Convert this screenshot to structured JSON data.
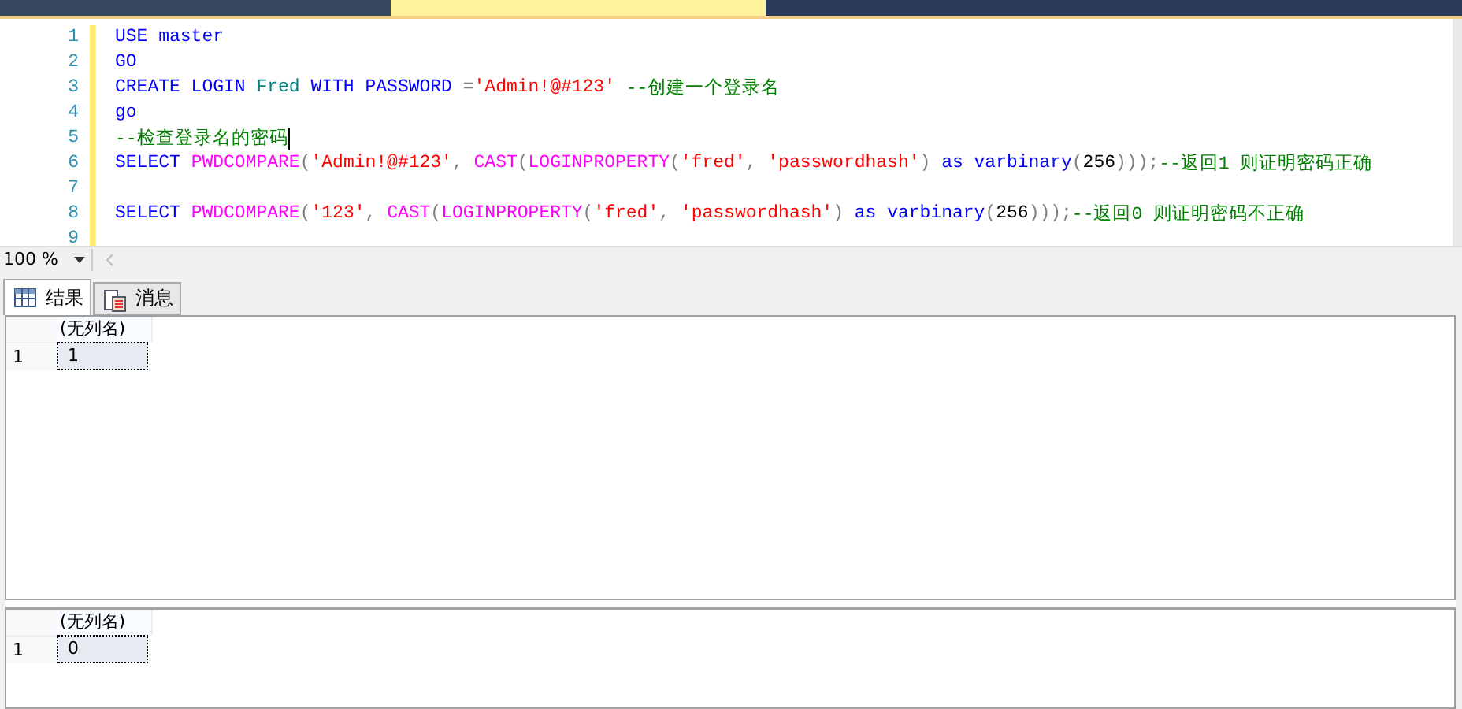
{
  "document_tabs": [
    {
      "selected": false
    },
    {
      "selected": true
    }
  ],
  "editor": {
    "lines": [
      {
        "number": "1",
        "tokens": [
          {
            "kind": "keyword",
            "text": "USE master"
          }
        ]
      },
      {
        "number": "2",
        "tokens": [
          {
            "kind": "keyword",
            "text": "GO"
          }
        ]
      },
      {
        "number": "3",
        "tokens": [
          {
            "kind": "keyword",
            "text": "CREATE LOGIN "
          },
          {
            "kind": "object",
            "text": "Fred"
          },
          {
            "kind": "keyword",
            "text": " WITH PASSWORD "
          },
          {
            "kind": "operator",
            "text": "="
          },
          {
            "kind": "string",
            "text": "'Admin!@#123'"
          },
          {
            "kind": "comment",
            "text": " --创建一个登录名"
          }
        ]
      },
      {
        "number": "4",
        "tokens": [
          {
            "kind": "keyword",
            "text": "go"
          }
        ]
      },
      {
        "number": "5",
        "tokens": [
          {
            "kind": "comment",
            "text": "--检查登录名的密码"
          }
        ],
        "cursor": true
      },
      {
        "number": "6",
        "tokens": [
          {
            "kind": "keyword",
            "text": "SELECT "
          },
          {
            "kind": "function",
            "text": "PWDCOMPARE"
          },
          {
            "kind": "operator",
            "text": "("
          },
          {
            "kind": "string",
            "text": "'Admin!@#123'"
          },
          {
            "kind": "operator",
            "text": ", "
          },
          {
            "kind": "function",
            "text": "CAST"
          },
          {
            "kind": "operator",
            "text": "("
          },
          {
            "kind": "function",
            "text": "LOGINPROPERTY"
          },
          {
            "kind": "operator",
            "text": "("
          },
          {
            "kind": "string",
            "text": "'fred'"
          },
          {
            "kind": "operator",
            "text": ", "
          },
          {
            "kind": "string",
            "text": "'passwordhash'"
          },
          {
            "kind": "operator",
            "text": ")"
          },
          {
            "kind": "keyword",
            "text": " as varbinary"
          },
          {
            "kind": "operator",
            "text": "("
          },
          {
            "kind": "plain",
            "text": "256"
          },
          {
            "kind": "operator",
            "text": ")));"
          },
          {
            "kind": "comment",
            "text": "--返回1 则证明密码正确"
          }
        ]
      },
      {
        "number": "7"
      },
      {
        "number": "8",
        "tokens": [
          {
            "kind": "keyword",
            "text": "SELECT "
          },
          {
            "kind": "function",
            "text": "PWDCOMPARE"
          },
          {
            "kind": "operator",
            "text": "("
          },
          {
            "kind": "string",
            "text": "'123'"
          },
          {
            "kind": "operator",
            "text": ", "
          },
          {
            "kind": "function",
            "text": "CAST"
          },
          {
            "kind": "operator",
            "text": "("
          },
          {
            "kind": "function",
            "text": "LOGINPROPERTY"
          },
          {
            "kind": "operator",
            "text": "("
          },
          {
            "kind": "string",
            "text": "'fred'"
          },
          {
            "kind": "operator",
            "text": ", "
          },
          {
            "kind": "string",
            "text": "'passwordhash'"
          },
          {
            "kind": "operator",
            "text": ")"
          },
          {
            "kind": "keyword",
            "text": " as varbinary"
          },
          {
            "kind": "operator",
            "text": "("
          },
          {
            "kind": "plain",
            "text": "256"
          },
          {
            "kind": "operator",
            "text": ")));"
          },
          {
            "kind": "comment",
            "text": "--返回0 则证明密码不正确"
          }
        ]
      },
      {
        "number": "9"
      }
    ]
  },
  "zoom": {
    "value": "100 %"
  },
  "result_tabs": [
    {
      "label": "结果",
      "kind": "grid",
      "selected": true
    },
    {
      "label": "消息",
      "kind": "messages",
      "selected": false
    }
  ],
  "result_grids": [
    {
      "columns": [
        "(无列名)"
      ],
      "rows": [
        {
          "number": "1",
          "cells": [
            {
              "text": "1",
              "selected": true
            }
          ]
        }
      ]
    },
    {
      "columns": [
        "(无列名)"
      ],
      "rows": [
        {
          "number": "1",
          "cells": [
            {
              "text": "0",
              "selected": true
            }
          ]
        }
      ]
    }
  ]
}
